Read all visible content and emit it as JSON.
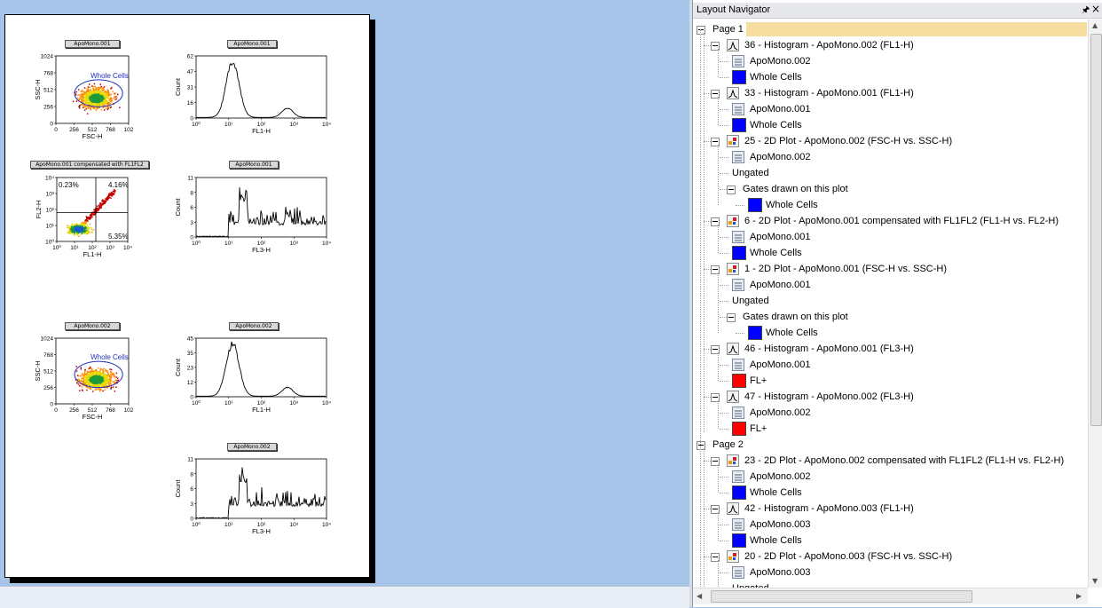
{
  "layout": {
    "plots": [
      {
        "title": "ApoMono.001",
        "type": "2d",
        "xlabel": "FSC-H",
        "ylabel": "SSC-H",
        "yticks": [
          "1024",
          "768",
          "512",
          "256",
          "0"
        ],
        "xticks": [
          "0",
          "256",
          "512",
          "768",
          "102"
        ],
        "gate": "Whole Cells"
      },
      {
        "title": "ApoMono.001",
        "type": "hist",
        "xlabel": "FL1-H",
        "ylabel": "Count",
        "yticks": [
          "62",
          "47",
          "31",
          "16",
          "0"
        ],
        "xticks": [
          "10⁰",
          "10¹",
          "10²",
          "10³",
          "10⁴"
        ]
      },
      {
        "title": "ApoMono.001 compensated with FL1FL2",
        "type": "quad",
        "xlabel": "FL1-H",
        "ylabel": "FL2-H",
        "yticks": [
          "10⁴",
          "10³",
          "10²",
          "10¹",
          "10⁰"
        ],
        "xticks": [
          "10⁰",
          "10¹",
          "10²",
          "10³",
          "10⁴"
        ],
        "quadrants": [
          "0.23%",
          "4.16%",
          "5.35%"
        ]
      },
      {
        "title": "ApoMono.001",
        "type": "hist",
        "xlabel": "FL3-H",
        "ylabel": "Count",
        "yticks": [
          "11",
          "8",
          "6",
          "3",
          "0"
        ],
        "xticks": [
          "10⁰",
          "10¹",
          "10²",
          "10³",
          "10⁴"
        ]
      },
      {
        "title": "ApoMono.002",
        "type": "2d",
        "xlabel": "FSC-H",
        "ylabel": "SSC-H",
        "yticks": [
          "1024",
          "768",
          "512",
          "256",
          "0"
        ],
        "xticks": [
          "0",
          "256",
          "512",
          "768",
          "102"
        ],
        "gate": "Whole Cells"
      },
      {
        "title": "ApoMono.002",
        "type": "hist",
        "xlabel": "FL1-H",
        "ylabel": "Count",
        "yticks": [
          "45",
          "35",
          "23",
          "12",
          "0"
        ],
        "xticks": [
          "10⁰",
          "10¹",
          "10²",
          "10³",
          "10⁴"
        ]
      },
      {
        "title": "ApoMono.002",
        "type": "hist",
        "xlabel": "FL3-H",
        "ylabel": "Count",
        "yticks": [
          "11",
          "8",
          "6",
          "3",
          "0"
        ],
        "xticks": [
          "10⁰",
          "10¹",
          "10²",
          "10³",
          "10⁴"
        ]
      }
    ]
  },
  "navigator": {
    "title": "Layout Navigator",
    "pin_icon": "pin-icon",
    "close_icon": "close-icon",
    "tree": [
      {
        "level": 0,
        "kind": "page",
        "label": "Page 1",
        "expander": true,
        "selected": true
      },
      {
        "level": 1,
        "kind": "hist",
        "label": "36 - Histogram - ApoMono.002 (FL1-H)",
        "expander": true
      },
      {
        "level": 2,
        "kind": "sample",
        "label": "ApoMono.002"
      },
      {
        "level": 2,
        "kind": "gate",
        "label": "Whole Cells",
        "color": "#0000ff"
      },
      {
        "level": 1,
        "kind": "hist",
        "label": "33 - Histogram - ApoMono.001 (FL1-H)",
        "expander": true
      },
      {
        "level": 2,
        "kind": "sample",
        "label": "ApoMono.001"
      },
      {
        "level": 2,
        "kind": "gate",
        "label": "Whole Cells",
        "color": "#0000ff"
      },
      {
        "level": 1,
        "kind": "2d",
        "label": "25 - 2D Plot - ApoMono.002 (FSC-H vs. SSC-H)",
        "expander": true
      },
      {
        "level": 2,
        "kind": "sample",
        "label": "ApoMono.002"
      },
      {
        "level": 2,
        "kind": "text",
        "label": "Ungated"
      },
      {
        "level": 2,
        "kind": "text",
        "label": "Gates drawn on this plot",
        "expander": true
      },
      {
        "level": 3,
        "kind": "gate",
        "label": "Whole Cells",
        "color": "#0000ff"
      },
      {
        "level": 1,
        "kind": "2d",
        "label": "6 - 2D Plot - ApoMono.001 compensated with FL1FL2 (FL1-H vs. FL2-H)",
        "expander": true
      },
      {
        "level": 2,
        "kind": "sample",
        "label": "ApoMono.001"
      },
      {
        "level": 2,
        "kind": "gate",
        "label": "Whole Cells",
        "color": "#0000ff"
      },
      {
        "level": 1,
        "kind": "2d",
        "label": "1 - 2D Plot - ApoMono.001 (FSC-H vs. SSC-H)",
        "expander": true
      },
      {
        "level": 2,
        "kind": "sample",
        "label": "ApoMono.001"
      },
      {
        "level": 2,
        "kind": "text",
        "label": "Ungated"
      },
      {
        "level": 2,
        "kind": "text",
        "label": "Gates drawn on this plot",
        "expander": true
      },
      {
        "level": 3,
        "kind": "gate",
        "label": "Whole Cells",
        "color": "#0000ff"
      },
      {
        "level": 1,
        "kind": "hist",
        "label": "46 - Histogram - ApoMono.001 (FL3-H)",
        "expander": true
      },
      {
        "level": 2,
        "kind": "sample",
        "label": "ApoMono.001"
      },
      {
        "level": 2,
        "kind": "gate",
        "label": "FL+",
        "color": "#ff0000"
      },
      {
        "level": 1,
        "kind": "hist",
        "label": "47 - Histogram - ApoMono.002 (FL3-H)",
        "expander": true
      },
      {
        "level": 2,
        "kind": "sample",
        "label": "ApoMono.002"
      },
      {
        "level": 2,
        "kind": "gate",
        "label": "FL+",
        "color": "#ff0000"
      },
      {
        "level": 0,
        "kind": "page",
        "label": "Page 2",
        "expander": true
      },
      {
        "level": 1,
        "kind": "2d",
        "label": "23 - 2D Plot - ApoMono.002 compensated with FL1FL2 (FL1-H vs. FL2-H)",
        "expander": true
      },
      {
        "level": 2,
        "kind": "sample",
        "label": "ApoMono.002"
      },
      {
        "level": 2,
        "kind": "gate",
        "label": "Whole Cells",
        "color": "#0000ff"
      },
      {
        "level": 1,
        "kind": "hist",
        "label": "42 - Histogram - ApoMono.003 (FL1-H)",
        "expander": true
      },
      {
        "level": 2,
        "kind": "sample",
        "label": "ApoMono.003"
      },
      {
        "level": 2,
        "kind": "gate",
        "label": "Whole Cells",
        "color": "#0000ff"
      },
      {
        "level": 1,
        "kind": "2d",
        "label": "20 - 2D Plot - ApoMono.003 (FSC-H vs. SSC-H)",
        "expander": true
      },
      {
        "level": 2,
        "kind": "sample",
        "label": "ApoMono.003"
      },
      {
        "level": 2,
        "kind": "text",
        "label": "Ungated"
      }
    ]
  }
}
